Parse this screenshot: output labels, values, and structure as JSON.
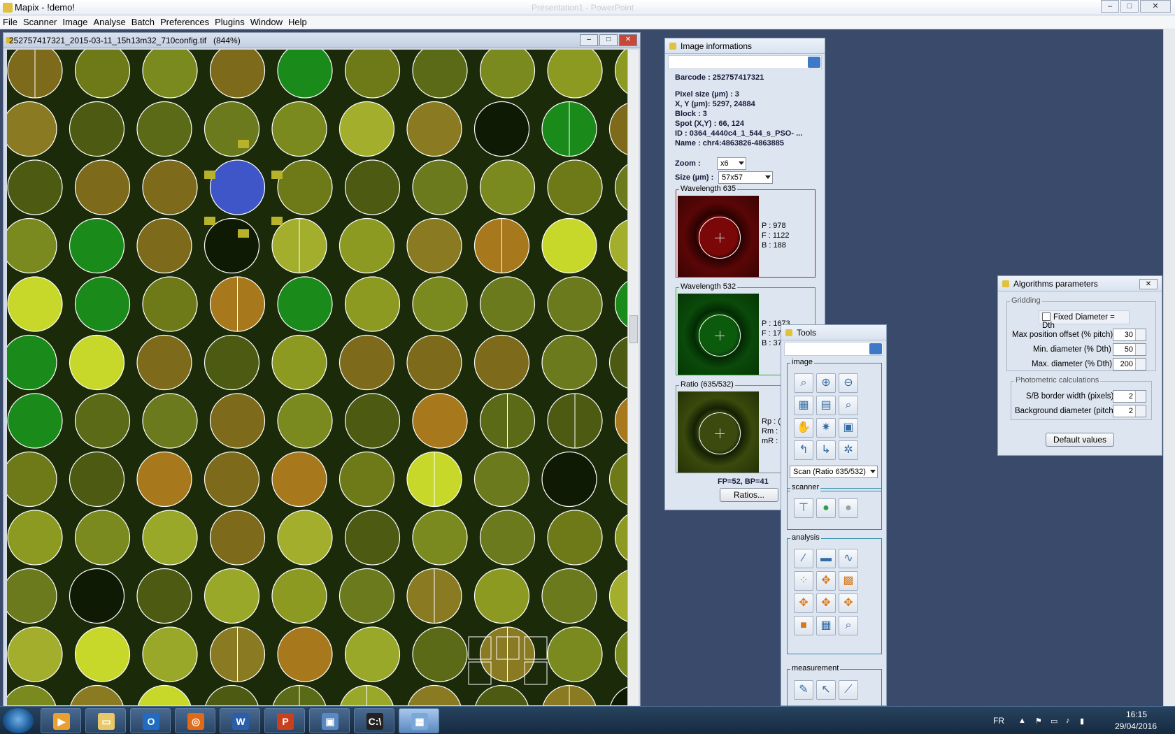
{
  "window": {
    "title": "Mapix - !demo!",
    "ghost_title": "Présentation1 - PowerPoint",
    "min": "‒",
    "max": "□",
    "close": "✕"
  },
  "menu": [
    "File",
    "Scanner",
    "Image",
    "Analyse",
    "Batch",
    "Preferences",
    "Plugins",
    "Window",
    "Help"
  ],
  "image_window": {
    "filename": "252757417321_2015-03-11_15h13m32_710config.tif",
    "zoom": "(844%)"
  },
  "info_panel": {
    "title": "Image informations",
    "barcode": "Barcode : 252757417321",
    "pixel_size": "Pixel size (µm) : 3",
    "xy": "X, Y (µm): 5297, 24884",
    "block": "Block : 3",
    "spot": "Spot (X,Y) : 66, 124",
    "id": "ID : 0364_4440c4_1_544_s_PSO- ...",
    "name": "Name : chr4:4863826-4863885",
    "zoom_label": "Zoom :",
    "zoom_value": "x6",
    "size_label": "Size (µm) :",
    "size_value": "57x57",
    "wl635": {
      "label": "Wavelength 635",
      "p": "P : 978",
      "f": "F : 1122",
      "b": "B : 188"
    },
    "wl532": {
      "label": "Wavelength 532",
      "p": "P : 1673",
      "f": "F : 17",
      "b": "B : 37"
    },
    "ratio": {
      "label": "Ratio (635/532)",
      "rp": "Rp : (",
      "rm": "Rm : (",
      "mr": "mR : ("
    },
    "fp_bp": "FP=52, BP=41",
    "ratios_button": "Ratios..."
  },
  "tools_panel": {
    "title": "Tools",
    "image_label": "image",
    "scan_combo": "Scan (Ratio 635/532)",
    "scanner_label": "scanner",
    "analysis_label": "analysis",
    "measurement_label": "measurement",
    "image_icons": [
      "zoom-fit-icon",
      "zoom-in-icon",
      "zoom-out-icon",
      "histogram-icon",
      "notes-icon",
      "zoom-region-icon",
      "hand-icon",
      "brightness-icon",
      "snapshot-icon",
      "undo-icon",
      "redo-icon",
      "network-icon"
    ],
    "scanner_icons": [
      "scanner-tree-icon",
      "scanner-start-icon",
      "scanner-stop-icon"
    ],
    "analysis_icons": [
      "grid-align-icon",
      "block-icon",
      "profile-icon",
      "auto-spot-icon",
      "move-manual-icon",
      "move-block-icon",
      "auto-grid-a-icon",
      "auto-grid-b-icon",
      "auto-grid-c-icon",
      "spot-icon",
      "table-icon",
      "search-icon"
    ],
    "measurement_icons": [
      "pencil-icon",
      "pointer-icon",
      "ruler-icon"
    ]
  },
  "algo_panel": {
    "title": "Algorithms parameters",
    "gridding_label": "Gridding",
    "fixed_diameter": "Fixed Diameter = Dth",
    "max_pos_label": "Max position offset (% pitch)",
    "max_pos_value": "30",
    "min_diam_label": "Min. diameter (% Dth)",
    "min_diam_value": "50",
    "max_diam_label": "Max. diameter (% Dth)",
    "max_diam_value": "200",
    "photometric_label": "Photometric calculations",
    "sb_label": "S/B border width (pixels)",
    "sb_value": "2",
    "bg_label": "Background diameter (pitch)",
    "bg_value": "2",
    "default_button": "Default values"
  },
  "taskbar": {
    "lang": "FR",
    "time": "16:15",
    "date": "29/04/2016",
    "apps": [
      "media-player-icon",
      "explorer-icon",
      "outlook-icon",
      "firefox-icon",
      "word-icon",
      "powerpoint-icon",
      "photo-viewer-icon",
      "cmd-icon",
      "mapix-icon"
    ]
  },
  "colors": {
    "mdi_background": "#3a4a6b",
    "panel_background": "#dde5f0",
    "selected_spot": "#3e56c8",
    "grid_marker": "#b8b22a"
  }
}
